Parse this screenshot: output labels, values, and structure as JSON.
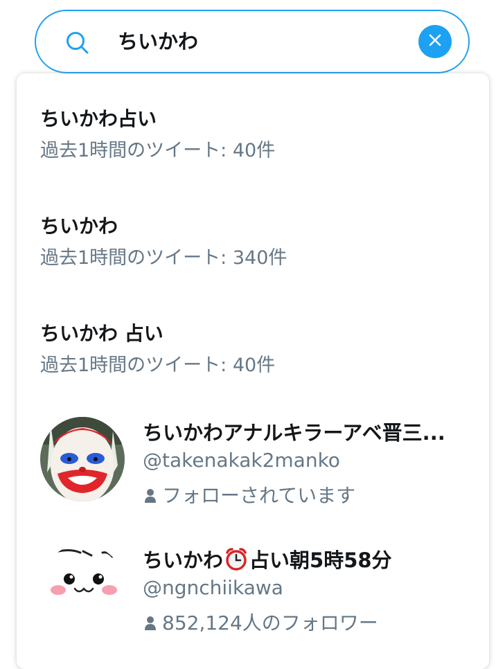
{
  "search": {
    "query": "ちいかわ"
  },
  "suggestions": [
    {
      "title": "ちいかわ占い",
      "subtitle": "過去1時間のツイート: 40件"
    },
    {
      "title": "ちいかわ",
      "subtitle": "過去1時間のツイート: 340件"
    },
    {
      "title": "ちいかわ 占い",
      "subtitle": "過去1時間のツイート: 40件"
    }
  ],
  "users": [
    {
      "name": "ちいかわアナルキラーアベ晋三...",
      "handle": "@takenakak2manko",
      "meta": "フォローされています"
    },
    {
      "name_before_icon": "ちいかわ",
      "name_after_icon": "占い朝5時58分",
      "name_icon": "alarm-clock-icon",
      "handle": "@ngnchiikawa",
      "meta": "852,124人のフォロワー"
    }
  ],
  "colors": {
    "accent": "#1da1f2",
    "primary_text": "#14171a",
    "secondary_text": "#657786"
  }
}
